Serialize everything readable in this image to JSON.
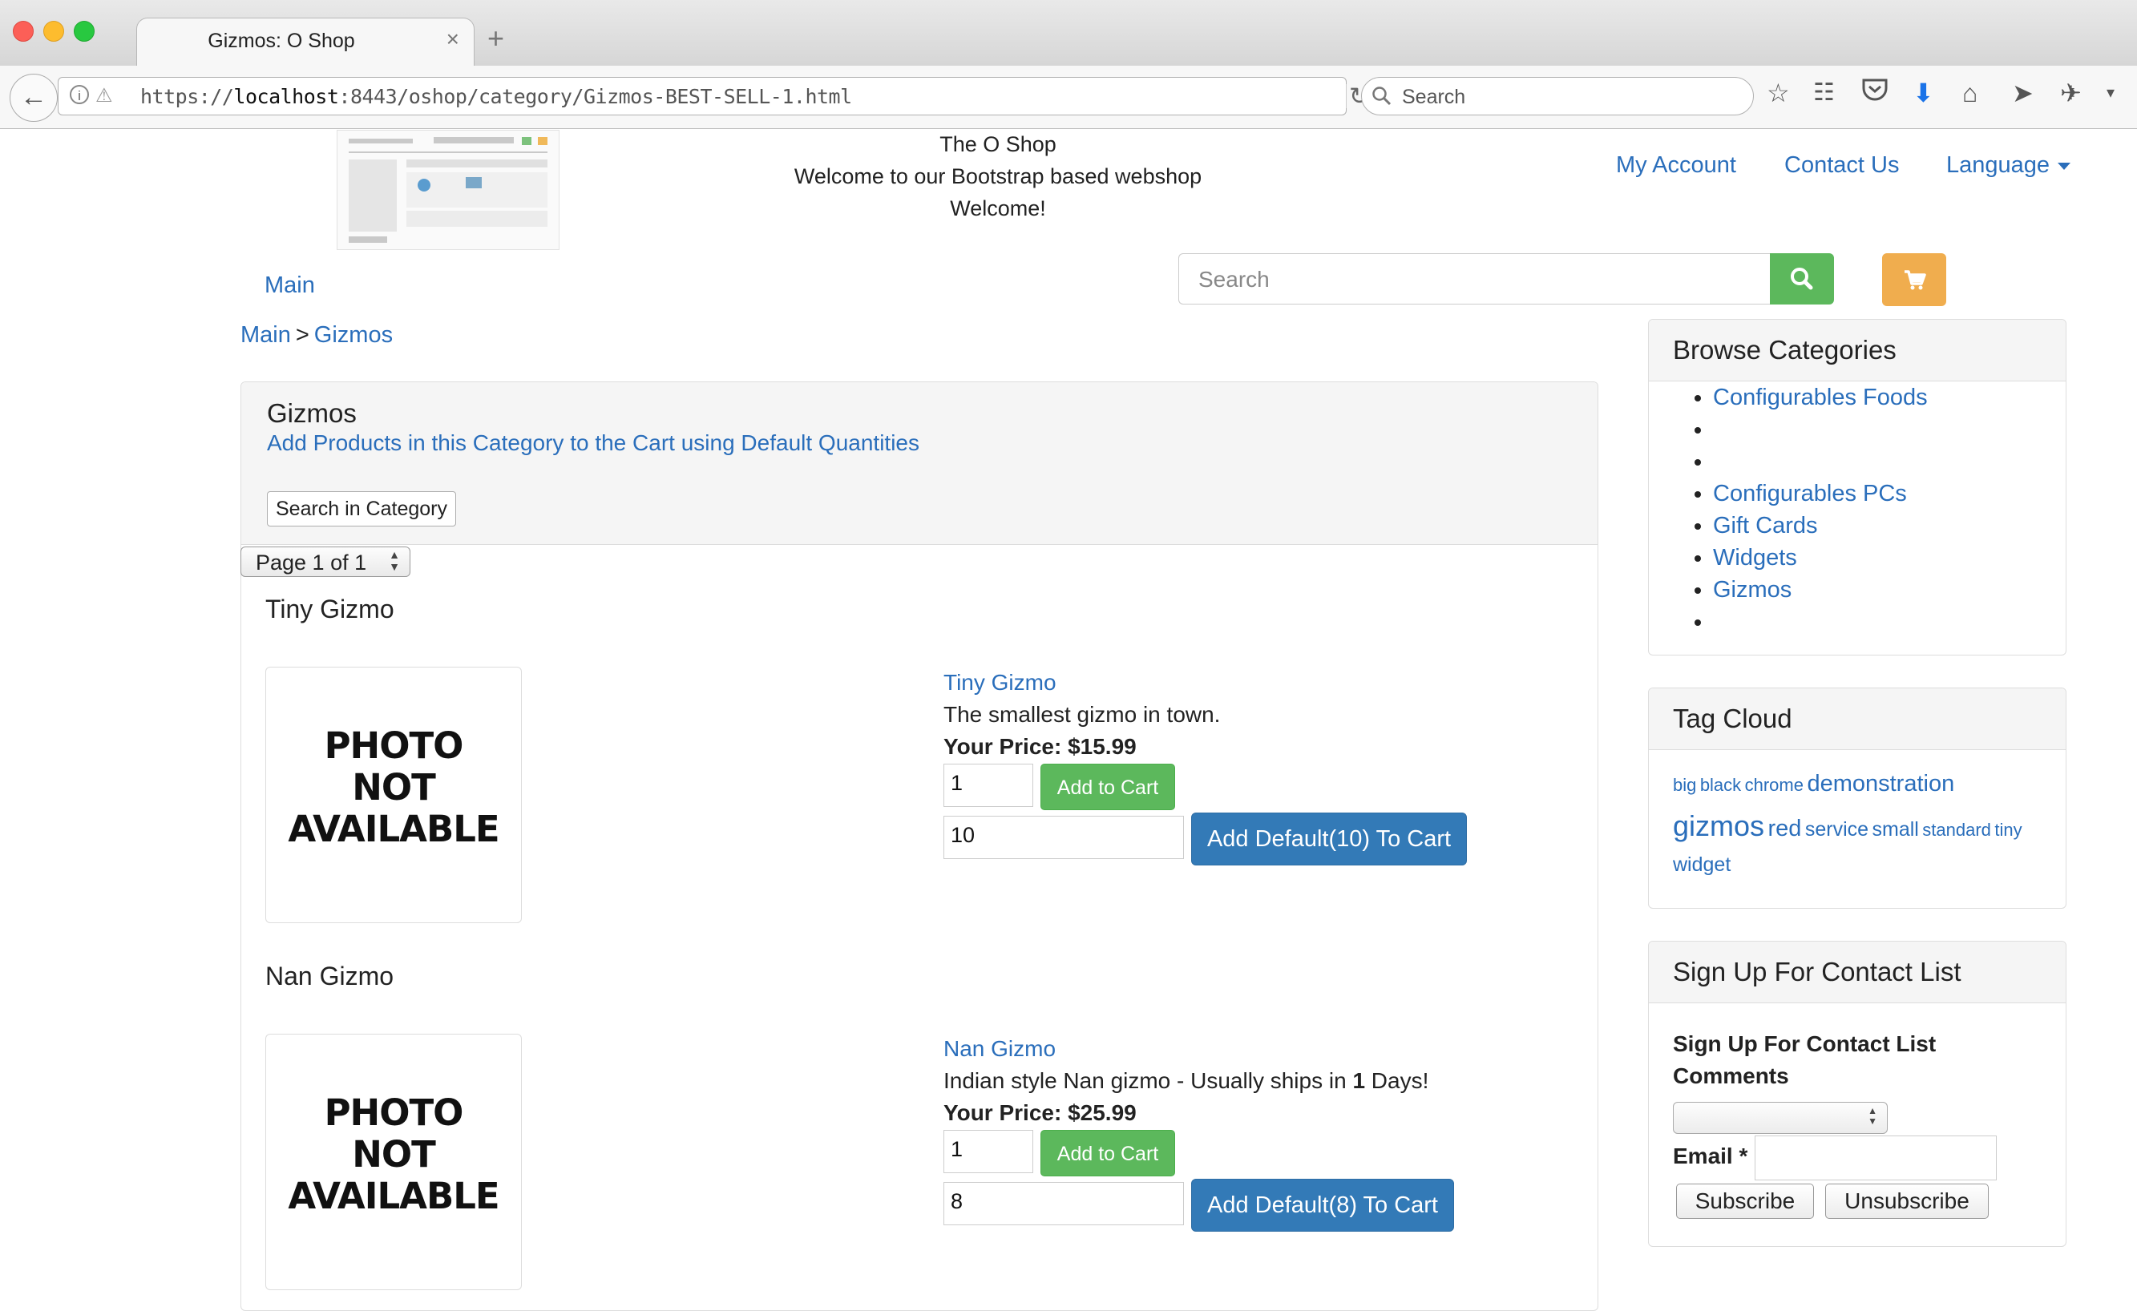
{
  "browser": {
    "tab_title": "Gizmos: O Shop",
    "tab_close": "×",
    "new_tab": "+",
    "url_prefix": "https://",
    "url_host": "localhost",
    "url_rest": ":8443/oshop/category/Gizmos-BEST-SELL-1.html",
    "search_placeholder": "Search",
    "icons": [
      "back-icon",
      "info-icon",
      "lock-icon",
      "reload-icon",
      "search-icon",
      "star-icon",
      "reading-list-icon",
      "pocket-icon",
      "download-icon",
      "home-icon",
      "send-icon",
      "extension-icon",
      "menu-chevron-icon"
    ]
  },
  "header": {
    "line1": "The O Shop",
    "line2": "Welcome to our Bootstrap based webshop",
    "line3": "Welcome!",
    "my_account": "My Account",
    "contact_us": "Contact Us",
    "language": "Language",
    "main_nav": "Main",
    "search_placeholder": "Search"
  },
  "breadcrumb": {
    "home": "Main",
    "separator": ">",
    "current": "Gizmos"
  },
  "category": {
    "title": "Gizmos",
    "add_all_link": "Add Products in this Category to the Cart using Default Quantities",
    "search_button": "Search in Category",
    "page_select": "Page 1 of 1"
  },
  "products": [
    {
      "title": "Tiny Gizmo",
      "photo_text": [
        "PHOTO",
        "NOT",
        "AVAILABLE"
      ],
      "link": "Tiny Gizmo",
      "description": "The smallest gizmo in town.",
      "price_label": "Your Price:",
      "price": "$15.99",
      "qty": "1",
      "add_label": "Add to Cart",
      "default_qty": "10",
      "add_default_label": "Add Default(10) To Cart"
    },
    {
      "title": "Nan Gizmo",
      "photo_text": [
        "PHOTO",
        "NOT",
        "AVAILABLE"
      ],
      "link": "Nan Gizmo",
      "description_pre": "Indian style Nan gizmo - Usually ships in ",
      "description_bold": "1",
      "description_post": " Days!",
      "price_label": "Your Price:",
      "price": "$25.99",
      "qty": "1",
      "add_label": "Add to Cart",
      "default_qty": "8",
      "add_default_label": "Add Default(8) To Cart"
    }
  ],
  "sidebar": {
    "browse_title": "Browse Categories",
    "categories": [
      "Configurables Foods",
      "",
      "",
      "Configurables PCs",
      "Gift Cards",
      "Widgets",
      "Gizmos",
      ""
    ],
    "tag_cloud_title": "Tag Cloud",
    "tags": [
      {
        "label": "big",
        "size": "small"
      },
      {
        "label": "black",
        "size": "small"
      },
      {
        "label": "chrome",
        "size": "small"
      },
      {
        "label": "demonstration",
        "size": "medium"
      },
      {
        "label": "gizmos",
        "size": "large"
      },
      {
        "label": "red",
        "size": "medium"
      },
      {
        "label": "service",
        "size": "small-medium"
      },
      {
        "label": "small",
        "size": "small-medium"
      },
      {
        "label": "standard",
        "size": "small"
      },
      {
        "label": "tiny",
        "size": "small"
      },
      {
        "label": "widget",
        "size": "small-medium"
      }
    ],
    "signup_title": "Sign Up For Contact List",
    "signup_label_1": "Sign Up For Contact List",
    "signup_label_2": "Comments",
    "email_label": "Email",
    "required_mark": "*",
    "subscribe": "Subscribe",
    "unsubscribe": "Unsubscribe"
  },
  "colors": {
    "link": "#2a6ebb",
    "success": "#5cb85c",
    "primary": "#337ab7",
    "warning": "#f0ad4e"
  }
}
